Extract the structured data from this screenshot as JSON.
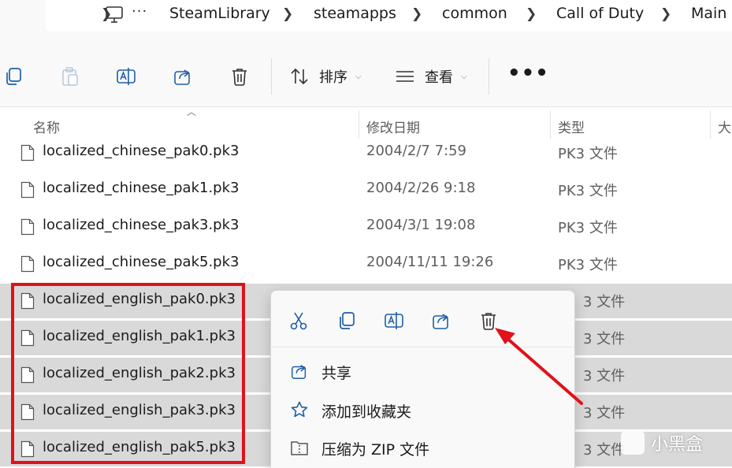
{
  "breadcrumb": {
    "more_glyph": "···",
    "items": [
      "SteamLibrary",
      "steamapps",
      "common",
      "Call of Duty",
      "Main"
    ]
  },
  "toolbar": {
    "sort_label": "排序",
    "view_label": "查看",
    "more_glyph": "•••"
  },
  "columns": {
    "name": "名称",
    "date": "修改日期",
    "type": "类型",
    "size": "大"
  },
  "files": [
    {
      "name": "localized_chinese_pak0.pk3",
      "date": "2004/2/7 7:59",
      "type": "PK3 文件",
      "selected": false
    },
    {
      "name": "localized_chinese_pak1.pk3",
      "date": "2004/2/26 9:18",
      "type": "PK3 文件",
      "selected": false
    },
    {
      "name": "localized_chinese_pak3.pk3",
      "date": "2004/3/1 19:08",
      "type": "PK3 文件",
      "selected": false
    },
    {
      "name": "localized_chinese_pak5.pk3",
      "date": "2004/11/11 19:26",
      "type": "PK3 文件",
      "selected": false
    },
    {
      "name": "localized_english_pak0.pk3",
      "date": "",
      "type": "3 文件",
      "selected": true
    },
    {
      "name": "localized_english_pak1.pk3",
      "date": "",
      "type": "3 文件",
      "selected": true
    },
    {
      "name": "localized_english_pak2.pk3",
      "date": "",
      "type": "3 文件",
      "selected": true
    },
    {
      "name": "localized_english_pak3.pk3",
      "date": "",
      "type": "3 文件",
      "selected": true
    },
    {
      "name": "localized_english_pak5.pk3",
      "date": "",
      "type": "3 文件",
      "selected": true
    }
  ],
  "context_menu": {
    "items": [
      {
        "label": "共享",
        "icon": "share-icon"
      },
      {
        "label": "添加到收藏夹",
        "icon": "star-icon"
      },
      {
        "label": "压缩为 ZIP 文件",
        "icon": "zip-folder-icon"
      }
    ]
  },
  "watermark": {
    "text": "小黑盒"
  },
  "colors": {
    "highlight": "#e0111a",
    "selection": "#d9d9d9",
    "accent": "#2f6fb3"
  }
}
